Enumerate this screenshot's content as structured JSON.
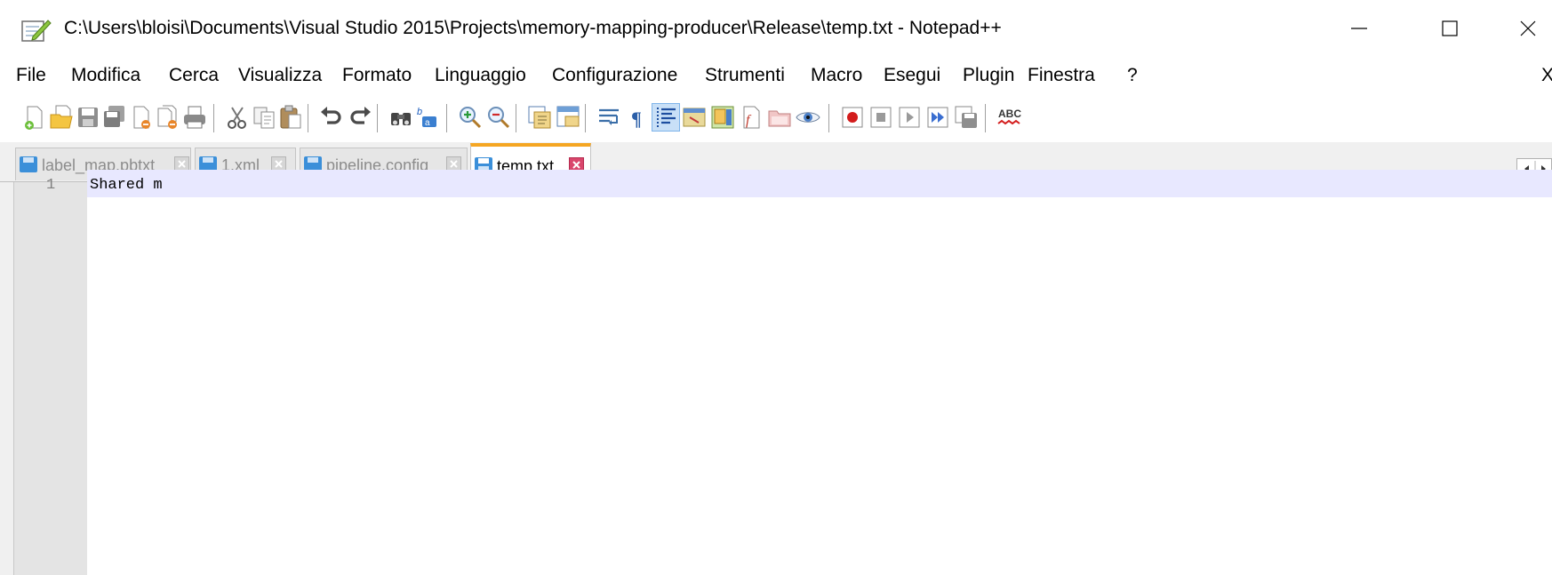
{
  "window": {
    "title": "C:\\Users\\bloisi\\Documents\\Visual Studio 2015\\Projects\\memory-mapping-producer\\Release\\temp.txt - Notepad++",
    "app_icon": "notepad-plus-plus-icon",
    "controls": [
      "minimize-icon",
      "maximize-icon",
      "close-icon"
    ]
  },
  "menu": {
    "items": [
      "File",
      "Modifica",
      "Cerca",
      "Visualizza",
      "Formato",
      "Linguaggio",
      "Configurazione",
      "Strumenti",
      "Macro",
      "Esegui",
      "Plugin",
      "Finestra",
      "?"
    ],
    "close_label": "X"
  },
  "toolbar": {
    "icons": [
      "new-file-icon",
      "open-file-icon",
      "save-icon",
      "save-all-icon",
      "close-icon",
      "close-all-icon",
      "print-icon",
      "cut-icon",
      "copy-icon",
      "paste-icon",
      "undo-icon",
      "redo-icon",
      "find-icon",
      "replace-icon",
      "zoom-in-icon",
      "zoom-out-icon",
      "sync-vertical-icon",
      "sync-horizontal-icon",
      "word-wrap-icon",
      "show-all-chars-icon",
      "indent-guide-icon",
      "user-language-icon",
      "document-map-icon",
      "function-list-icon",
      "folder-as-workspace-icon",
      "monitoring-icon",
      "record-macro-icon",
      "stop-macro-icon",
      "play-macro-icon",
      "run-macro-multiple-icon",
      "save-macro-icon",
      "spell-check-icon"
    ],
    "active_icon": "indent-guide-icon",
    "spell_label": "ABC"
  },
  "tabs": [
    {
      "label": "label_map.pbtxt",
      "active": false
    },
    {
      "label": "1.xml",
      "active": false
    },
    {
      "label": "pipeline.config",
      "active": false
    },
    {
      "label": "temp.txt",
      "active": true
    }
  ],
  "editor": {
    "lines": [
      {
        "number": "1",
        "text": "Shared m"
      }
    ]
  },
  "colors": {
    "active_tab_accent": "#f5a623",
    "current_line": "#e8e8ff",
    "gutter": "#e4e4e4",
    "tab_save_icon": "#3b8fd9",
    "active_tab_close": "#d9466c"
  }
}
